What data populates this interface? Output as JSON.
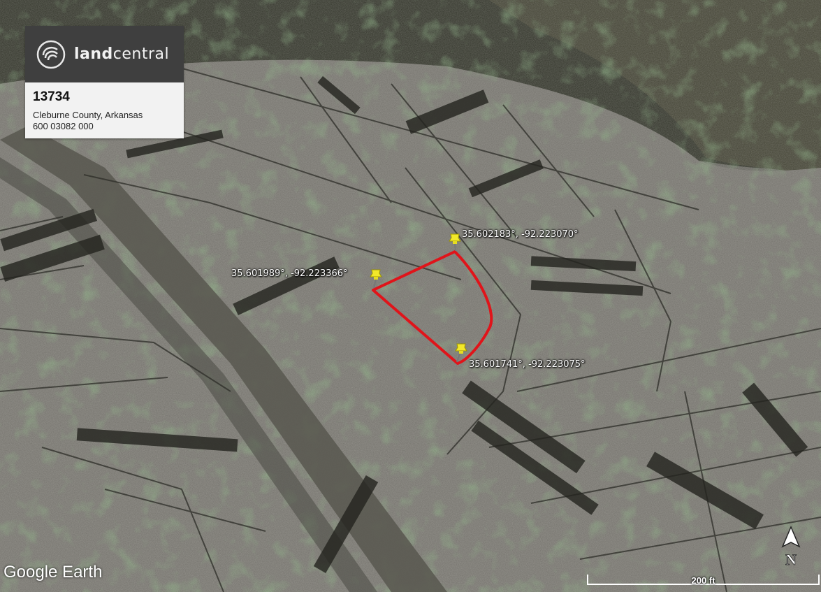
{
  "card": {
    "brand_bold": "land",
    "brand_rest": "central",
    "parcel_id": "13734",
    "county": "Cleburne County, Arkansas",
    "apn": "600 03082 000"
  },
  "markers": [
    {
      "label": "35.602183°, -92.223070°",
      "icon": "yellow-pushpin-icon"
    },
    {
      "label": "35.601989°, -92.223366°",
      "icon": "yellow-pushpin-icon"
    },
    {
      "label": "35.601741°, -92.223075°",
      "icon": "yellow-pushpin-icon"
    }
  ],
  "parcel_outline_color": "#e0141a",
  "watermark": "Google Earth",
  "scale_label": "200 ft",
  "north_label": "N"
}
